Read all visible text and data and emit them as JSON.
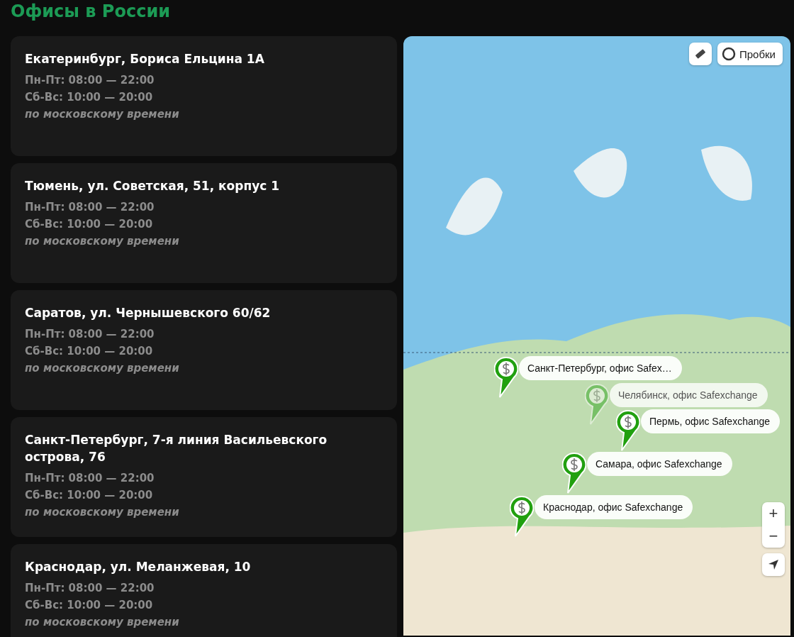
{
  "title": "Офисы в России",
  "offices": [
    {
      "address": "Екатеринбург, Бориса Ельцина 1А",
      "weekdays": "Пн-Пт: 08:00 — 22:00",
      "weekend": "Сб-Вс: 10:00 — 20:00",
      "note": "по московскому времени"
    },
    {
      "address": "Тюмень, ул. Советская, 51, корпус 1",
      "weekdays": "Пн-Пт: 08:00 — 22:00",
      "weekend": "Сб-Вс: 10:00 — 20:00",
      "note": "по московскому времени"
    },
    {
      "address": "Саратов, ул. Чернышевского 60/62",
      "weekdays": "Пн-Пт: 08:00 — 22:00",
      "weekend": "Сб-Вс: 10:00 — 20:00",
      "note": "по московскому времени"
    },
    {
      "address": "Санкт-Петербург, 7-я линия Васильевского острова, 76",
      "weekdays": "Пн-Пт: 08:00 — 22:00",
      "weekend": "Сб-Вс: 10:00 — 20:00",
      "note": "по московскому времени"
    },
    {
      "address": "Краснодар, ул. Меланжевая, 10",
      "weekdays": "Пн-Пт: 08:00 — 22:00",
      "weekend": "Сб-Вс: 10:00 — 20:00",
      "note": "по московскому времени"
    }
  ],
  "map": {
    "traffic_button": "Пробки",
    "zoom_in": "+",
    "zoom_out": "−",
    "markers": [
      {
        "label": "Санкт-Петербург, офис Safex…",
        "faded": false
      },
      {
        "label": "Челябинск, офис Safexchange",
        "faded": true
      },
      {
        "label": "Пермь, офис Safexchange",
        "faded": false
      },
      {
        "label": "Самара, офис Safexchange",
        "faded": false
      },
      {
        "label": "Краснодар, офис Safexchange",
        "faded": false
      }
    ]
  }
}
